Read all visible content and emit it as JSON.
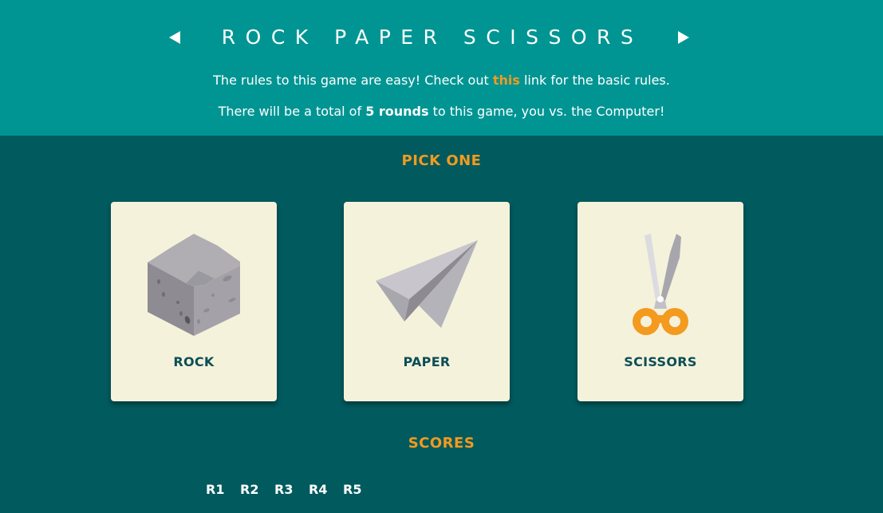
{
  "header": {
    "title": "ROCK PAPER SCISSORS",
    "intro_line1_before": "The rules to this game are easy! Check out ",
    "intro_line1_link": "this",
    "intro_line1_after": " link for the basic rules.",
    "intro_line2_before": "There will be a total of ",
    "intro_line2_bold": "5 rounds",
    "intro_line2_after": " to this game, you vs. the Computer!",
    "prev_icon": "triangle-left-icon",
    "next_icon": "triangle-right-icon"
  },
  "pick": {
    "heading": "PICK ONE",
    "choices": [
      {
        "label": "ROCK",
        "icon": "rock-icon"
      },
      {
        "label": "PAPER",
        "icon": "paper-plane-icon"
      },
      {
        "label": "SCISSORS",
        "icon": "scissors-icon"
      }
    ]
  },
  "scores": {
    "heading": "SCORES",
    "rounds": [
      "R1",
      "R2",
      "R3",
      "R4",
      "R5"
    ]
  },
  "colors": {
    "header_bg": "#009593",
    "body_bg": "#005a5e",
    "accent": "#f39a1f",
    "card_bg": "#f5f2dc",
    "card_text": "#0b4f55"
  }
}
